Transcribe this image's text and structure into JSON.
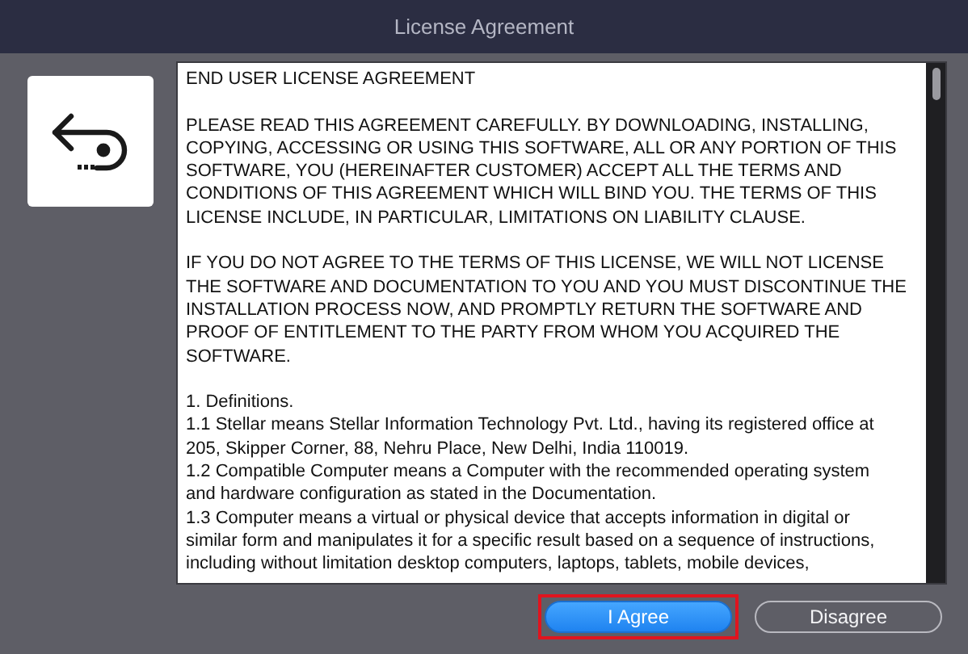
{
  "window": {
    "title": "License Agreement"
  },
  "license": {
    "paragraphs": [
      [
        "END USER LICENSE AGREEMENT"
      ],
      [
        "PLEASE READ THIS AGREEMENT CAREFULLY. BY DOWNLOADING, INSTALLING,",
        "COPYING, ACCESSING OR USING THIS SOFTWARE, ALL OR ANY PORTION OF THIS",
        "SOFTWARE, YOU (HEREINAFTER CUSTOMER) ACCEPT ALL THE TERMS AND",
        "CONDITIONS OF THIS AGREEMENT WHICH WILL BIND YOU. THE TERMS OF THIS",
        "LICENSE INCLUDE, IN PARTICULAR, LIMITATIONS ON LIABILITY CLAUSE."
      ],
      [
        "IF YOU DO NOT AGREE TO THE TERMS OF THIS LICENSE, WE WILL NOT LICENSE",
        "THE SOFTWARE AND DOCUMENTATION TO YOU AND YOU MUST DISCONTINUE THE",
        "INSTALLATION PROCESS NOW, AND PROMPTLY RETURN THE SOFTWARE AND",
        "PROOF OF ENTITLEMENT TO THE PARTY FROM WHOM YOU ACQUIRED THE",
        "SOFTWARE."
      ],
      [
        "1. Definitions.",
        "1.1 Stellar means Stellar Information Technology Pvt. Ltd., having its registered office at",
        "205, Skipper Corner, 88, Nehru Place, New Delhi, India 110019.",
        "1.2 Compatible Computer means a Computer with the recommended operating system",
        "and hardware configuration as stated in the Documentation.",
        "1.3 Computer means a virtual or physical device that accepts information in digital or",
        "similar form and manipulates it for a specific result based on a sequence of instructions,",
        "including without limitation desktop computers, laptops, tablets, mobile devices,"
      ]
    ]
  },
  "buttons": [
    {
      "label": "I Agree",
      "kind": "primary",
      "highlighted": true
    },
    {
      "label": "Disagree",
      "kind": "secondary",
      "highlighted": false
    }
  ]
}
